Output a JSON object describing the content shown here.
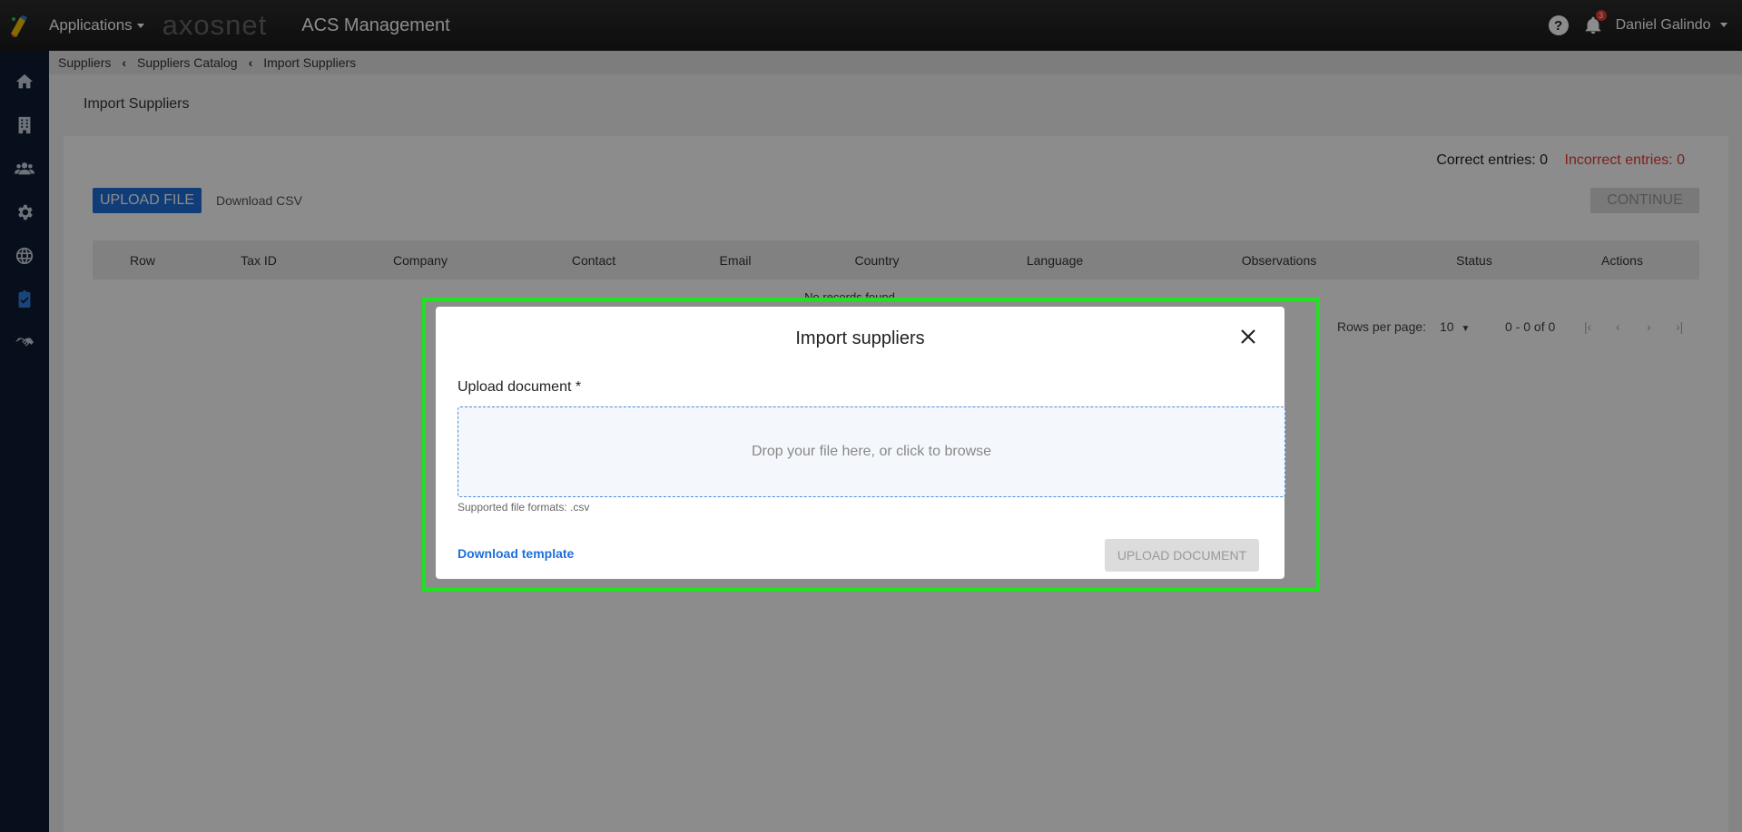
{
  "topbar": {
    "applications_label": "Applications",
    "brand_text": "axosnet",
    "app_title": "ACS Management",
    "user_name": "Daniel Galindo",
    "notification_count": "3",
    "help_label": "?"
  },
  "sidebar": {
    "items": [
      {
        "icon": "home-icon"
      },
      {
        "icon": "building-icon"
      },
      {
        "icon": "users-icon"
      },
      {
        "icon": "gear-icon"
      },
      {
        "icon": "globe-icon"
      },
      {
        "icon": "clipboard-check-icon",
        "active": true
      },
      {
        "icon": "handshake-icon"
      }
    ]
  },
  "breadcrumb": {
    "items": [
      "Suppliers",
      "Suppliers Catalog",
      "Import Suppliers"
    ]
  },
  "page": {
    "title": "Import Suppliers",
    "correct_entries": "Correct entries: 0",
    "incorrect_entries": "Incorrect entries: 0",
    "upload_file_label": "UPLOAD FILE",
    "download_csv_label": "Download CSV",
    "continue_label": "CONTINUE",
    "no_records": "No records found"
  },
  "table": {
    "columns": [
      "Row",
      "Tax ID",
      "Company",
      "Contact",
      "Email",
      "Country",
      "Language",
      "Observations",
      "Status",
      "Actions"
    ]
  },
  "pagination": {
    "rows_per_page_label": "Rows per page:",
    "rows_per_page_value": "10",
    "range": "0 - 0 of 0"
  },
  "modal": {
    "title": "Import suppliers",
    "upload_label": "Upload document *",
    "dropzone_text": "Drop your file here, or click to browse",
    "formats_text": "Supported file formats: .csv",
    "download_template_label": "Download template",
    "upload_document_label": "UPLOAD DOCUMENT"
  },
  "colors": {
    "accent": "#1e6fdb",
    "error": "#e53935",
    "sidebar": "#0d1b33",
    "highlight": "#22e022"
  }
}
